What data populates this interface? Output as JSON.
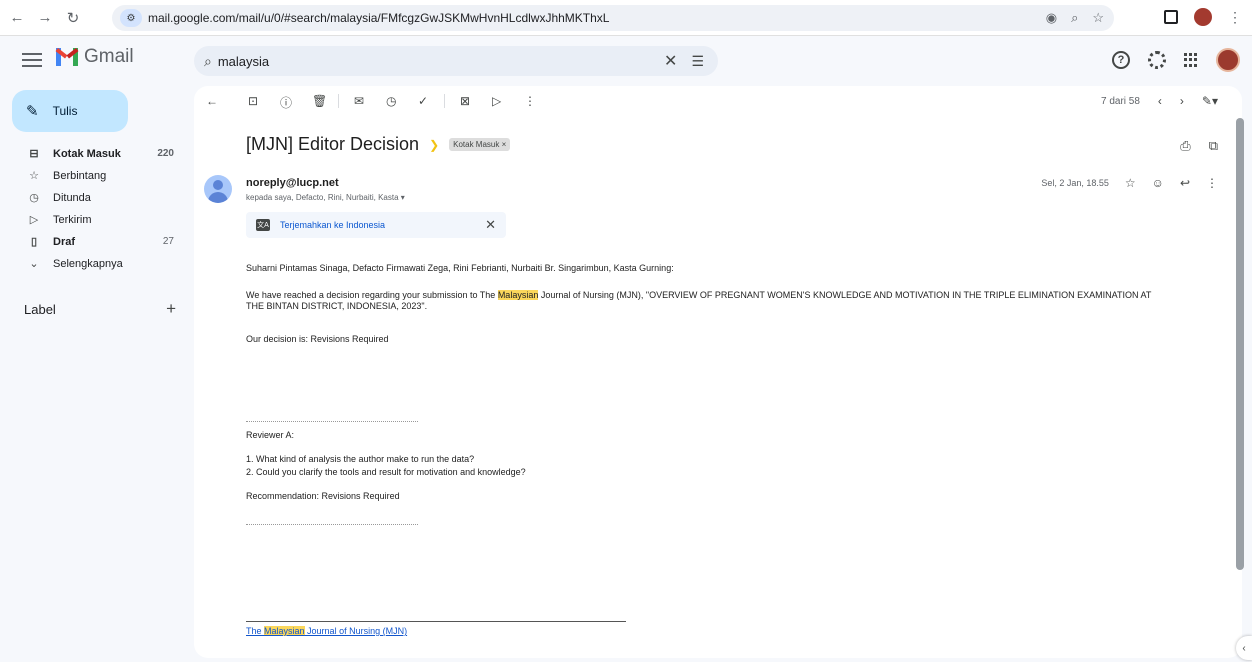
{
  "browser": {
    "url": "mail.google.com/mail/u/0/#search/malaysia/FMfcgzGwJSKMwHvnHLcdlwxJhhMKThxL",
    "icons": [
      "back-icon",
      "forward-icon",
      "reload-icon",
      "site-info-icon",
      "eye-icon",
      "zoom-icon",
      "bookmark-star-icon",
      "side-panel-icon",
      "profile-icon",
      "menu-icon"
    ]
  },
  "header": {
    "app_name": "Gmail",
    "search": {
      "value": "malaysia"
    }
  },
  "sidebar": {
    "compose_label": "Tulis",
    "items": [
      {
        "label": "Kotak Masuk",
        "count": "220",
        "bold": true,
        "icon": "inbox-icon"
      },
      {
        "label": "Berbintang",
        "count": "",
        "bold": false,
        "icon": "star-icon"
      },
      {
        "label": "Ditunda",
        "count": "",
        "bold": false,
        "icon": "clock-icon"
      },
      {
        "label": "Terkirim",
        "count": "",
        "bold": false,
        "icon": "send-icon"
      },
      {
        "label": "Draf",
        "count": "27",
        "bold": true,
        "icon": "draft-icon"
      },
      {
        "label": "Selengkapnya",
        "count": "",
        "bold": false,
        "icon": "chevron-down-icon"
      }
    ],
    "label_heading": "Label"
  },
  "toolbar": {
    "pager_text": "7 dari 58"
  },
  "email": {
    "subject": "[MJN] Editor Decision",
    "label_chip": "Kotak Masuk ×",
    "sender": "noreply@lucp.net",
    "recipients": "kepada saya, Defacto, Rini, Nurbaiti, Kasta ▾",
    "date": "Sel, 2 Jan, 18.55",
    "translate_link": "Terjemahkan ke Indonesia",
    "salutation": "Suharni Pintamas Sinaga, Defacto Firmawati Zega, Rini Febrianti, Nurbaiti Br. Singarimbun, Kasta Gurning:",
    "para1_a": "We have reached a decision regarding your submission to The ",
    "para1_hl": "Malaysian",
    "para1_b": " Journal of Nursing (MJN), \"OVERVIEW OF PREGNANT WOMEN'S KNOWLEDGE AND MOTIVATION IN THE TRIPLE ELIMINATION EXAMINATION AT",
    "para1_c": "THE BINTAN DISTRICT, INDONESIA, 2023\".",
    "decision": "Our decision is: Revisions Required",
    "reviewer": "Reviewer A:",
    "q1": "1. What kind of analysis the author make to run the data?",
    "q2": "2. Could you clarify the tools and result for motivation and knowledge?",
    "recommendation": "Recommendation: Revisions Required",
    "sig_a": "The ",
    "sig_hl": "Malaysian",
    "sig_b": " Journal of Nursing (MJN)"
  },
  "colors": {
    "compose_bg": "#c2e7ff",
    "highlight": "#fbd75b",
    "link": "#0b57d0",
    "search_bg": "#e9eef6"
  }
}
